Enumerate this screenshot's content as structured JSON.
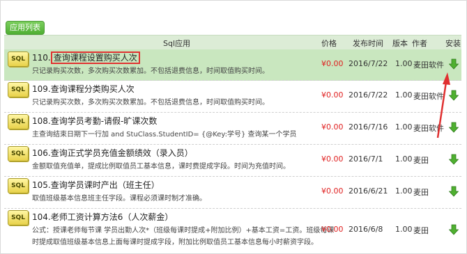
{
  "toolbar": {
    "app_list_label": "应用列表"
  },
  "columns": {
    "app": "Sql应用",
    "price": "价格",
    "date": "发布时间",
    "version": "版本",
    "author": "作者",
    "install": "安装"
  },
  "rows": [
    {
      "icon_text": "SQL",
      "number": "110.",
      "title": "查询课程设置购买人次",
      "desc": [
        "只记录购买次数，多次购买次数累加。不包括退费信息，时间取值购买时间。"
      ],
      "price": "¥0.00",
      "date": "2016/7/22",
      "version": "1.00",
      "author": "麦田软件"
    },
    {
      "icon_text": "SQL",
      "number": "",
      "title": "109.查询课程分类购买人次",
      "desc": [
        "只记录购买次数，多次购买次数累加。不包括退费信息，时间取值购买时间。"
      ],
      "price": "¥0.00",
      "date": "2016/7/22",
      "version": "1.00",
      "author": "麦田软件"
    },
    {
      "icon_text": "SQL",
      "number": "",
      "title": "108.查询学员考勤-请假-旷课次数",
      "desc": [
        "主查询结束日期下一行加 and StuClass.StudentID= {@Key:学号} 查询某一个学员"
      ],
      "price": "¥0.00",
      "date": "2016/7/16",
      "version": "1.00",
      "author": "麦田软件"
    },
    {
      "icon_text": "SQL",
      "number": "",
      "title": "106.查询正式学员充值金额绩效（录入员）",
      "desc": [
        "金额取值充值单，提成比例取值员工基本信息，课时费提成字段。时间为充值时间。"
      ],
      "price": "¥0.00",
      "date": "2016/7/1",
      "version": "1.00",
      "author": "麦田"
    },
    {
      "icon_text": "SQL",
      "number": "",
      "title": "105.查询学员课时产出（班主任）",
      "desc": [
        "取值班级基本信息班主任字段。课程必须课时制才准确。"
      ],
      "price": "¥0.00",
      "date": "2016/6/21",
      "version": "1.00",
      "author": "麦田"
    },
    {
      "icon_text": "SQL",
      "number": "",
      "title": "104.老师工资计算方法6（人次薪金）",
      "desc": [
        "公式：授课老师每节课 学员出勤人次*（班级每课时提成+附加比例）+基本工资=工资。班级每课",
        "时提成取值班级基本信息上面每课时提成字段，附加比例取值员工基本信息每小时薪资字段。"
      ],
      "price": "¥0.00",
      "date": "2016/6/8",
      "version": "1.00",
      "author": "麦田"
    }
  ],
  "colors": {
    "highlight": "#c9e7bf",
    "accent": "#4fae33",
    "price": "#e02020",
    "annotation": "#e03030"
  },
  "install_icon": "green-down-arrow-icon"
}
